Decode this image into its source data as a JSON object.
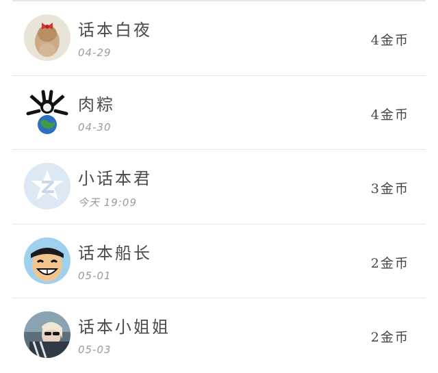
{
  "items": [
    {
      "name": "话本白夜",
      "date": "04-29",
      "amount": "4金币",
      "avatar": "girl-with-red-bow-avatar"
    },
    {
      "name": "肉粽",
      "date": "04-30",
      "amount": "4金币",
      "avatar": "skull-and-globe-avatar"
    },
    {
      "name": "小话本君",
      "date": "今天 19:09",
      "amount": "3金币",
      "avatar": "default-z-logo-avatar"
    },
    {
      "name": "话本船长",
      "date": "05-01",
      "amount": "2金币",
      "avatar": "straw-hat-pirate-avatar"
    },
    {
      "name": "话本小姐姐",
      "date": "05-03",
      "amount": "2金币",
      "avatar": "sunglasses-woman-avatar"
    }
  ]
}
